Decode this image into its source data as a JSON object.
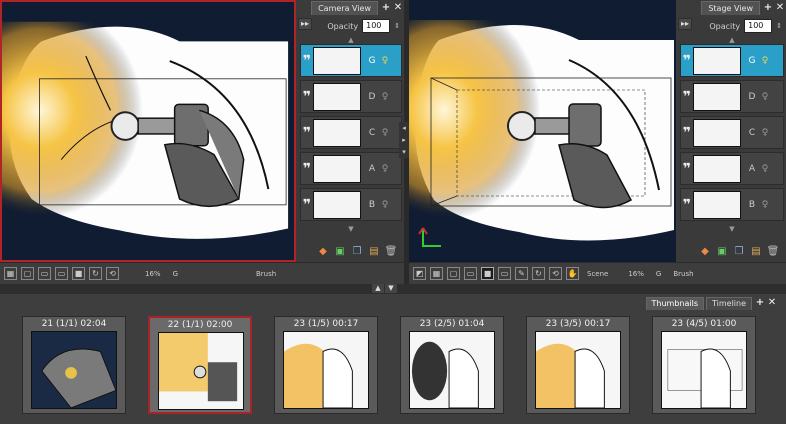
{
  "camera_view": {
    "tab_label": "Camera View",
    "opacity_label": "Opacity",
    "opacity_value": "100",
    "layers": [
      {
        "name": "G",
        "selected": true
      },
      {
        "name": "D",
        "selected": false
      },
      {
        "name": "C",
        "selected": false
      },
      {
        "name": "A",
        "selected": false
      },
      {
        "name": "B",
        "selected": false
      }
    ],
    "status": {
      "zoom": "16%",
      "layer": "G",
      "tool": "Brush"
    }
  },
  "stage_view": {
    "tab_label": "Stage View",
    "opacity_label": "Opacity",
    "opacity_value": "100",
    "status": {
      "mode": "Scene",
      "zoom": "16%",
      "layer": "G",
      "tool": "Brush"
    }
  },
  "thumbnails_panel": {
    "tabs": [
      "Thumbnails",
      "Timeline"
    ],
    "items": [
      {
        "label": "21 (1/1) 02:04",
        "selected": false
      },
      {
        "label": "22 (1/1) 02:00",
        "selected": true
      },
      {
        "label": "23 (1/5) 00:17",
        "selected": false
      },
      {
        "label": "23 (2/5) 01:04",
        "selected": false
      },
      {
        "label": "23 (3/5) 00:17",
        "selected": false
      },
      {
        "label": "23 (4/5) 01:00",
        "selected": false
      }
    ]
  },
  "colors": {
    "accent": "#2aa0c8",
    "selection": "#b02428"
  }
}
